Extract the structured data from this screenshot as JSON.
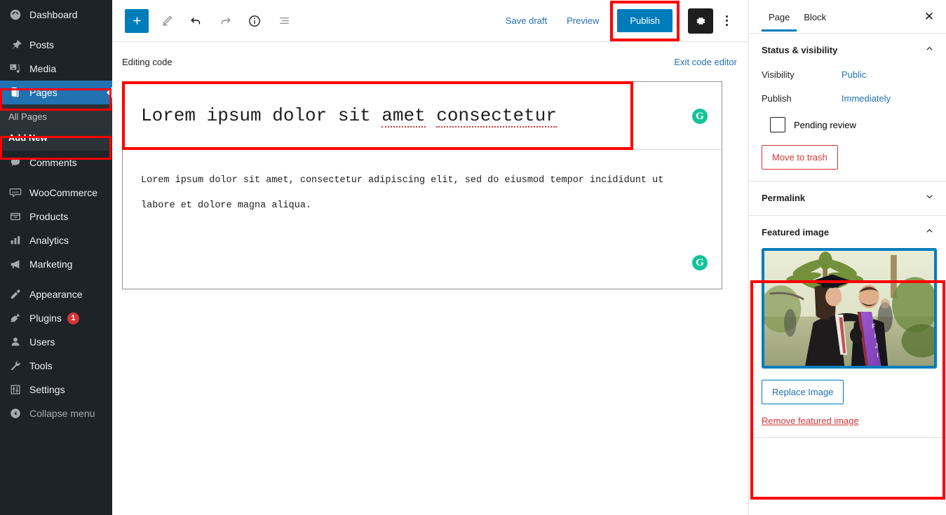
{
  "sidebar": {
    "items": [
      {
        "label": "Dashboard",
        "icon": "dashboard-icon",
        "state": "normal"
      },
      {
        "label": "Posts",
        "icon": "pin-icon",
        "state": "normal"
      },
      {
        "label": "Media",
        "icon": "media-icon",
        "state": "normal"
      },
      {
        "label": "Pages",
        "icon": "pages-icon",
        "state": "current"
      },
      {
        "label": "Comments",
        "icon": "comments-icon",
        "state": "normal"
      },
      {
        "label": "WooCommerce",
        "icon": "woocommerce-icon",
        "state": "normal"
      },
      {
        "label": "Products",
        "icon": "products-icon",
        "state": "normal"
      },
      {
        "label": "Analytics",
        "icon": "analytics-icon",
        "state": "normal"
      },
      {
        "label": "Marketing",
        "icon": "marketing-icon",
        "state": "normal"
      },
      {
        "label": "Appearance",
        "icon": "appearance-icon",
        "state": "normal"
      },
      {
        "label": "Plugins",
        "icon": "plugins-icon",
        "state": "normal",
        "badge": "1"
      },
      {
        "label": "Users",
        "icon": "users-icon",
        "state": "normal"
      },
      {
        "label": "Tools",
        "icon": "tools-icon",
        "state": "normal"
      },
      {
        "label": "Settings",
        "icon": "settings-icon",
        "state": "normal"
      },
      {
        "label": "Collapse menu",
        "icon": "collapse-icon",
        "state": "muted"
      }
    ],
    "submenu": [
      {
        "label": "All Pages",
        "active": false
      },
      {
        "label": "Add New",
        "active": true
      }
    ],
    "badge_color": "#d63638",
    "current_color": "#2271b1",
    "background": "#1d2327"
  },
  "toolbar": {
    "add_block_label": "+",
    "tools_icon": "pencil-icon",
    "undo_icon": "undo-icon",
    "redo_icon": "redo-icon",
    "info_icon": "info-icon",
    "list_view_icon": "list-view-icon",
    "save_draft_label": "Save draft",
    "preview_label": "Preview",
    "publish_label": "Publish",
    "settings_icon": "gear-icon",
    "more_icon": "more-options-icon",
    "publish_color": "#007cba"
  },
  "code_editor": {
    "status_label": "Editing code",
    "exit_label": "Exit code editor",
    "title_text": "Lorem ipsum dolor sit amet consectetur",
    "title_parts": [
      {
        "text": "Lorem ipsum dolor sit ",
        "misspelled": false
      },
      {
        "text": "amet",
        "misspelled": true
      },
      {
        "text": " ",
        "misspelled": false
      },
      {
        "text": "consectetur",
        "misspelled": true
      }
    ],
    "body_line_1": "Lorem ipsum dolor sit amet, consectetur adipiscing elit, sed do eiusmod tempor incididunt ut",
    "body_line_2": "labore et dolore magna aliqua.",
    "grammarly_glyph": "G",
    "grammarly_color": "#15c39a"
  },
  "right_panel": {
    "tabs": [
      {
        "label": "Page",
        "active": true
      },
      {
        "label": "Block",
        "active": false
      }
    ],
    "close_glyph": "✕",
    "status_section": {
      "title": "Status & visibility",
      "chevron": "˄",
      "rows": [
        {
          "label": "Visibility",
          "value": "Public"
        },
        {
          "label": "Publish",
          "value": "Immediately"
        }
      ],
      "pending_review_label": "Pending review",
      "trash_label": "Move to trash"
    },
    "permalink_section": {
      "title": "Permalink",
      "chevron": "˅"
    },
    "featured_section": {
      "title": "Featured image",
      "chevron": "˄",
      "replace_label": "Replace Image",
      "remove_label": "Remove featured image",
      "image_alt": "graduation-photo",
      "image_border_color": "#007cba"
    }
  },
  "highlights": {
    "color": "#ff0000",
    "targets": [
      "pages-nav-item",
      "add-new-submenu-item",
      "publish-button",
      "code-title-field",
      "featured-image-panel"
    ]
  }
}
